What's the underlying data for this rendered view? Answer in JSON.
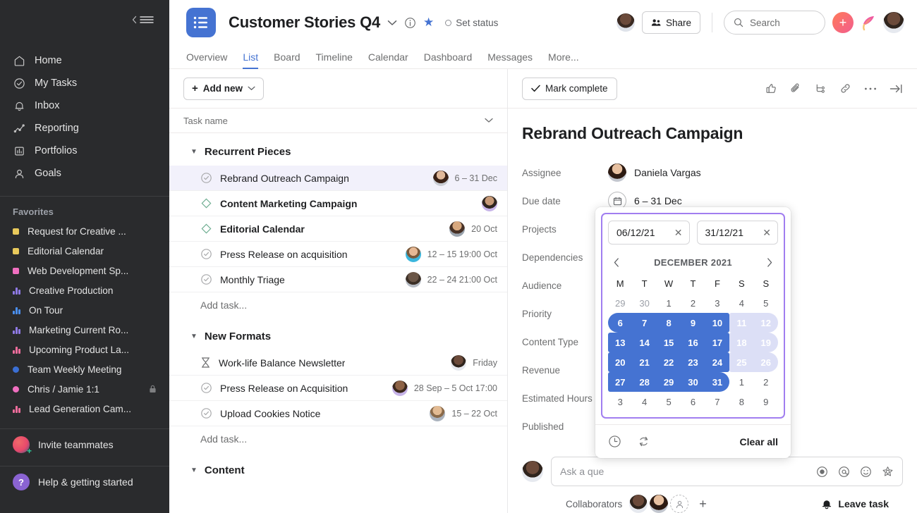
{
  "sidebar": {
    "collapse_icon": "collapse-menu-icon",
    "nav": [
      {
        "label": "Home",
        "icon": "home-icon"
      },
      {
        "label": "My Tasks",
        "icon": "check-circle-icon"
      },
      {
        "label": "Inbox",
        "icon": "bell-icon"
      },
      {
        "label": "Reporting",
        "icon": "line-chart-icon"
      },
      {
        "label": "Portfolios",
        "icon": "portfolio-icon"
      },
      {
        "label": "Goals",
        "icon": "goal-icon"
      }
    ],
    "favorites_title": "Favorites",
    "favorites": [
      {
        "label": "Request for Creative ...",
        "type": "dot",
        "color": "#e8c95b",
        "locked": false
      },
      {
        "label": "Editorial Calendar",
        "type": "dot",
        "color": "#e8c95b",
        "locked": false
      },
      {
        "label": "Web Development Sp...",
        "type": "dot",
        "color": "#f06fc0",
        "locked": false
      },
      {
        "label": "Creative Production",
        "type": "bars",
        "color": "#8f7ae5",
        "locked": false
      },
      {
        "label": "On Tour",
        "type": "bars",
        "color": "#4a8ff0",
        "locked": false
      },
      {
        "label": "Marketing Current Ro...",
        "type": "bars",
        "color": "#8f7ae5",
        "locked": false
      },
      {
        "label": "Upcoming Product La...",
        "type": "bars",
        "color": "#ef6d9c",
        "locked": false
      },
      {
        "label": "Team Weekly Meeting",
        "type": "dot",
        "color": "#3b6fd4",
        "locked": false
      },
      {
        "label": "Chris / Jamie 1:1",
        "type": "dot",
        "color": "#f06fc0",
        "locked": true
      },
      {
        "label": "Lead Generation Cam...",
        "type": "bars",
        "color": "#ef6d9c",
        "locked": false
      }
    ],
    "invite_label": "Invite teammates",
    "help_label": "Help & getting started",
    "help_glyph": "?"
  },
  "header": {
    "project_title": "Customer Stories Q4",
    "chevron_icon": "chevron-down-icon",
    "info_icon": "info-circle-icon",
    "star_icon": "star-icon",
    "set_status": "Set status",
    "share_label": "Share",
    "search_placeholder": "Search",
    "plus_glyph": "+",
    "tabs": [
      {
        "label": "Overview",
        "active": false
      },
      {
        "label": "List",
        "active": true
      },
      {
        "label": "Board",
        "active": false
      },
      {
        "label": "Timeline",
        "active": false
      },
      {
        "label": "Calendar",
        "active": false
      },
      {
        "label": "Dashboard",
        "active": false
      },
      {
        "label": "Messages",
        "active": false
      },
      {
        "label": "More...",
        "active": false
      }
    ]
  },
  "list": {
    "add_new_label": "Add new",
    "column_header": "Task name",
    "add_task_label": "Add task...",
    "groups": [
      {
        "name": "Recurrent Pieces",
        "tasks": [
          {
            "name": "Rebrand Outreach Campaign",
            "icon": "check-circle-icon",
            "date": "6 – 31 Dec",
            "bold": false,
            "selected": true,
            "avatar": "#8d6a5a"
          },
          {
            "name": "Content Marketing Campaign",
            "icon": "diamond-icon",
            "date": "",
            "bold": true,
            "selected": false,
            "avatar": "#b9a0e3"
          },
          {
            "name": "Editorial Calendar",
            "icon": "diamond-icon",
            "date": "20 Oct",
            "bold": true,
            "selected": false,
            "avatar": "#9a7a5c"
          },
          {
            "name": "Press Release on acquisition",
            "icon": "check-circle-icon",
            "date": "12 – 15 19:00 Oct",
            "bold": false,
            "selected": false,
            "avatar": "#53b9d8"
          },
          {
            "name": "Monthly Triage",
            "icon": "check-circle-icon",
            "date": "22 – 24 21:00 Oct",
            "bold": false,
            "selected": false,
            "avatar": "#6b6259"
          }
        ]
      },
      {
        "name": "New Formats",
        "tasks": [
          {
            "name": "Work-life Balance Newsletter",
            "icon": "hourglass-icon",
            "date": "Friday",
            "bold": false,
            "selected": false,
            "avatar": "#7a5a49"
          },
          {
            "name": "Press Release on Acquisition",
            "icon": "check-circle-icon",
            "date": "28 Sep – 5 Oct 17:00",
            "bold": false,
            "selected": false,
            "avatar": "#b9a0e3"
          },
          {
            "name": "Upload Cookies Notice",
            "icon": "check-circle-icon",
            "date": "15 – 22 Oct",
            "bold": false,
            "selected": false,
            "avatar": "#a08a6f"
          }
        ]
      },
      {
        "name": "Content",
        "tasks": []
      }
    ]
  },
  "detail": {
    "mark_complete_label": "Mark complete",
    "top_icons": [
      "thumbs-up-icon",
      "paperclip-icon",
      "subtask-icon",
      "link-icon",
      "more-horizontal-icon",
      "expand-right-icon"
    ],
    "title": "Rebrand Outreach Campaign",
    "fields": [
      {
        "label": "Assignee",
        "value": "Daniela Vargas"
      },
      {
        "label": "Due date",
        "value": "6 – 31 Dec"
      },
      {
        "label": "Projects",
        "value": ""
      },
      {
        "label": "Dependencies",
        "value": ""
      },
      {
        "label": "Audience",
        "value": ""
      },
      {
        "label": "Priority",
        "value": ""
      },
      {
        "label": "Content Type",
        "value": ""
      },
      {
        "label": "Revenue",
        "value": ""
      },
      {
        "label": "Estimated Hours",
        "value": ""
      },
      {
        "label": "Published",
        "value": ""
      }
    ],
    "composer_placeholder": "Ask a que",
    "composer_icons": [
      "record-icon",
      "mention-icon",
      "emoji-icon",
      "sticker-icon"
    ],
    "collaborators_label": "Collaborators",
    "collab_plus": "+",
    "leave_task_label": "Leave task",
    "leave_task_icon": "bell-icon"
  },
  "datepicker": {
    "start_value": "06/12/21",
    "end_value": "31/12/21",
    "clear_glyph": "✕",
    "prev_icon": "chevron-left-icon",
    "next_icon": "chevron-right-icon",
    "month_label": "DECEMBER 2021",
    "dow": [
      "M",
      "T",
      "W",
      "T",
      "F",
      "S",
      "S"
    ],
    "weeks": [
      [
        {
          "d": 29,
          "state": "muted"
        },
        {
          "d": 30,
          "state": "muted"
        },
        {
          "d": 1,
          "state": "normal"
        },
        {
          "d": 2,
          "state": "normal"
        },
        {
          "d": 3,
          "state": "normal"
        },
        {
          "d": 4,
          "state": "normal"
        },
        {
          "d": 5,
          "state": "normal"
        }
      ],
      [
        {
          "d": 6,
          "state": "sel",
          "edge": "start"
        },
        {
          "d": 7,
          "state": "sel"
        },
        {
          "d": 8,
          "state": "sel"
        },
        {
          "d": 9,
          "state": "sel"
        },
        {
          "d": 10,
          "state": "sel",
          "edge": "re"
        },
        {
          "d": 11,
          "state": "selwk",
          "edge": "rs"
        },
        {
          "d": 12,
          "state": "selwk",
          "edge": "end"
        }
      ],
      [
        {
          "d": 13,
          "state": "sel",
          "edge": "rs"
        },
        {
          "d": 14,
          "state": "sel"
        },
        {
          "d": 15,
          "state": "sel"
        },
        {
          "d": 16,
          "state": "sel"
        },
        {
          "d": 17,
          "state": "sel",
          "edge": "re"
        },
        {
          "d": 18,
          "state": "selwk",
          "edge": "rs"
        },
        {
          "d": 19,
          "state": "selwk",
          "edge": "end"
        }
      ],
      [
        {
          "d": 20,
          "state": "sel",
          "edge": "rs"
        },
        {
          "d": 21,
          "state": "sel"
        },
        {
          "d": 22,
          "state": "sel"
        },
        {
          "d": 23,
          "state": "sel"
        },
        {
          "d": 24,
          "state": "sel",
          "edge": "re"
        },
        {
          "d": 25,
          "state": "selwk",
          "edge": "rs"
        },
        {
          "d": 26,
          "state": "selwk",
          "edge": "end"
        }
      ],
      [
        {
          "d": 27,
          "state": "sel",
          "edge": "rs"
        },
        {
          "d": 28,
          "state": "sel"
        },
        {
          "d": 29,
          "state": "sel"
        },
        {
          "d": 30,
          "state": "sel"
        },
        {
          "d": 31,
          "state": "sel",
          "edge": "end"
        },
        {
          "d": 1,
          "state": "normal"
        },
        {
          "d": 2,
          "state": "normal"
        }
      ],
      [
        {
          "d": 3,
          "state": "normal"
        },
        {
          "d": 4,
          "state": "normal"
        },
        {
          "d": 5,
          "state": "normal"
        },
        {
          "d": 6,
          "state": "normal"
        },
        {
          "d": 7,
          "state": "normal"
        },
        {
          "d": 8,
          "state": "normal"
        },
        {
          "d": 9,
          "state": "normal"
        }
      ]
    ],
    "footer_icons": [
      "clock-icon",
      "repeat-icon"
    ],
    "clear_all_label": "Clear all"
  },
  "colors": {
    "accent_blue": "#4573d2",
    "picker_purple": "#a17ef0",
    "selected_row": "#f2f1fb",
    "weekend_fill": "#dcdff6",
    "sidebar_bg": "#2a2b2d"
  }
}
